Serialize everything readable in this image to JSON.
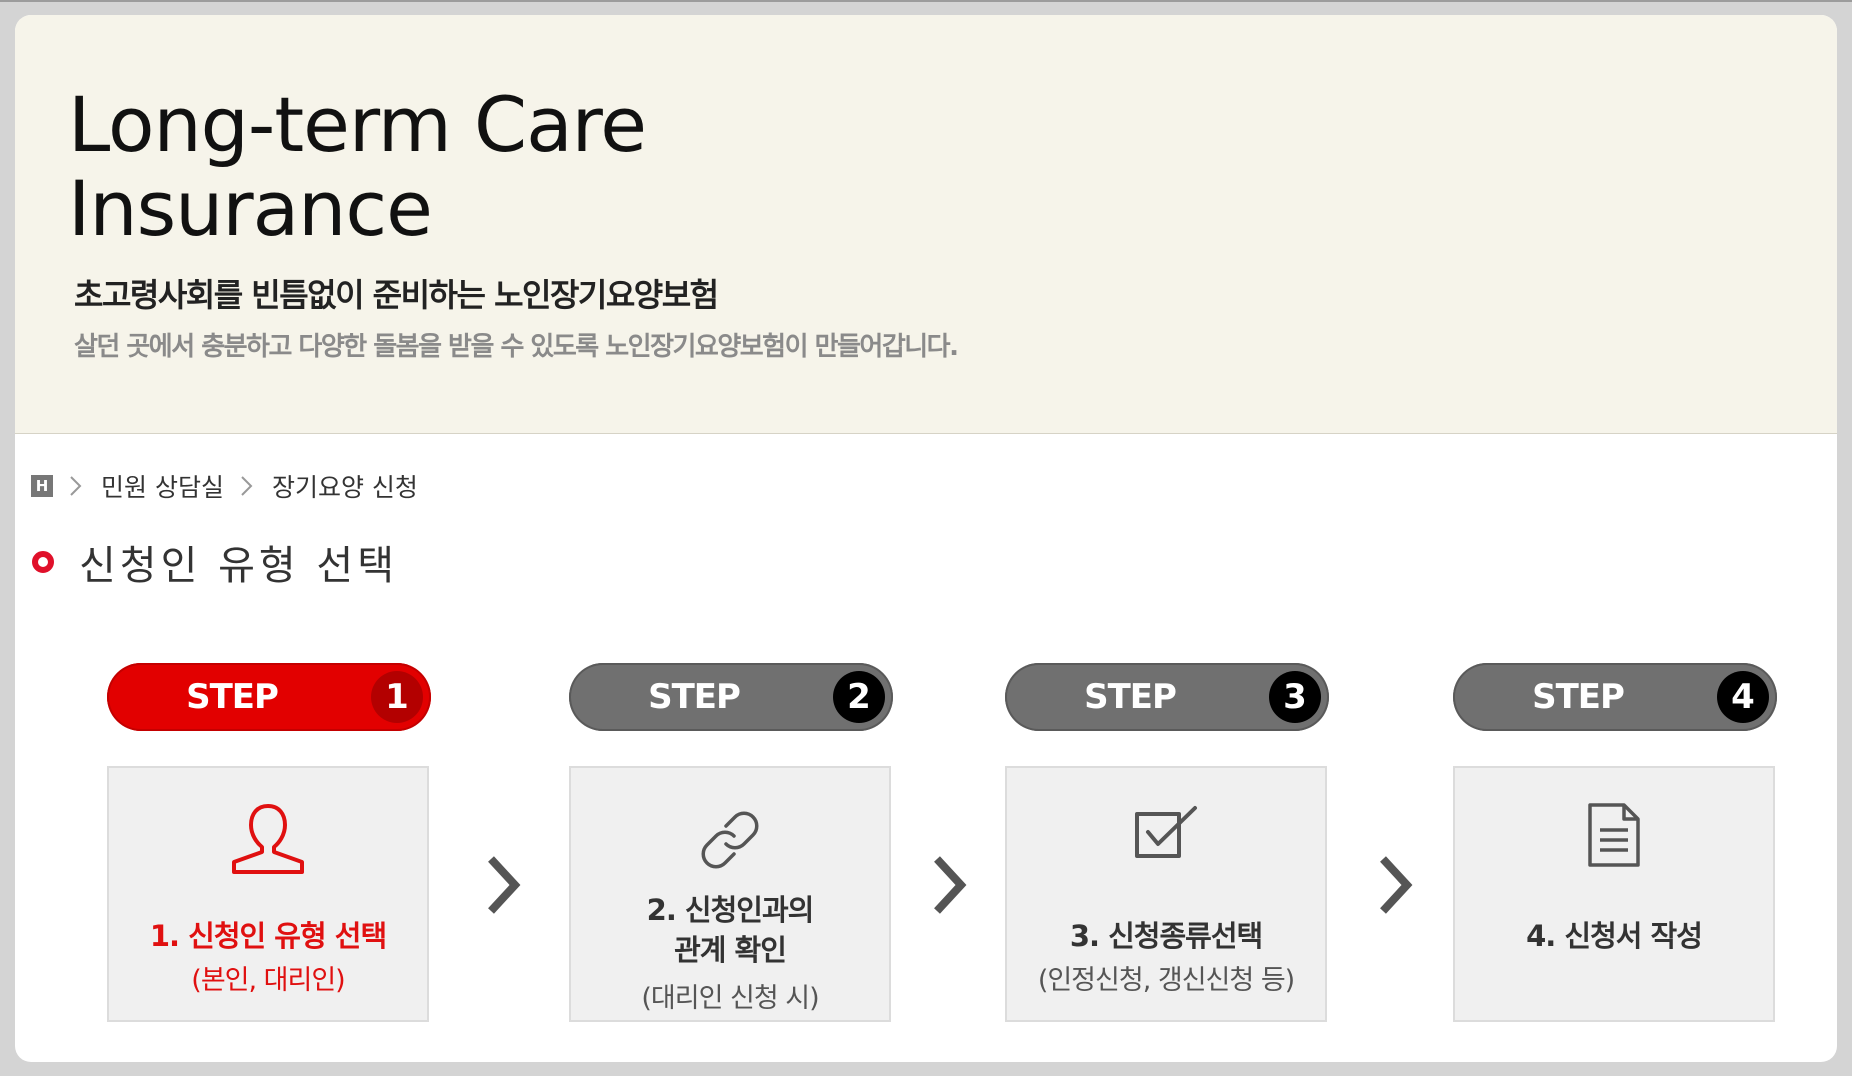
{
  "banner": {
    "title_line1": "Long-term Care",
    "title_line2": "Insurance",
    "subtitle": "초고령사회를 빈틈없이 준비하는 노인장기요양보험",
    "description": "살던 곳에서 충분하고 다양한 돌봄을 받을 수 있도록 노인장기요양보험이 만들어갑니다."
  },
  "breadcrumb": {
    "home_icon_text": "H",
    "items": [
      "민원 상담실",
      "장기요양 신청"
    ]
  },
  "heading": "신청인 유형 선택",
  "steps": [
    {
      "label": "STEP",
      "number": "1",
      "title": "1. 신청인 유형 선택",
      "note": "(본인, 대리인)",
      "icon": "person-icon",
      "active": true
    },
    {
      "label": "STEP",
      "number": "2",
      "title_line1": "2. 신청인과의",
      "title_line2": "관계 확인",
      "note": "(대리인 신청 시)",
      "icon": "link-icon",
      "active": false
    },
    {
      "label": "STEP",
      "number": "3",
      "title": "3. 신청종류선택",
      "note": "(인정신청, 갱신신청 등)",
      "icon": "checkbox-icon",
      "active": false
    },
    {
      "label": "STEP",
      "number": "4",
      "title": "4. 신청서 작성",
      "icon": "document-icon",
      "active": false
    }
  ],
  "colors": {
    "accent": "#e20000",
    "inactive_pill": "#707070",
    "banner_bg": "#f6f4ea",
    "card_bg": "#f0f0f0"
  }
}
